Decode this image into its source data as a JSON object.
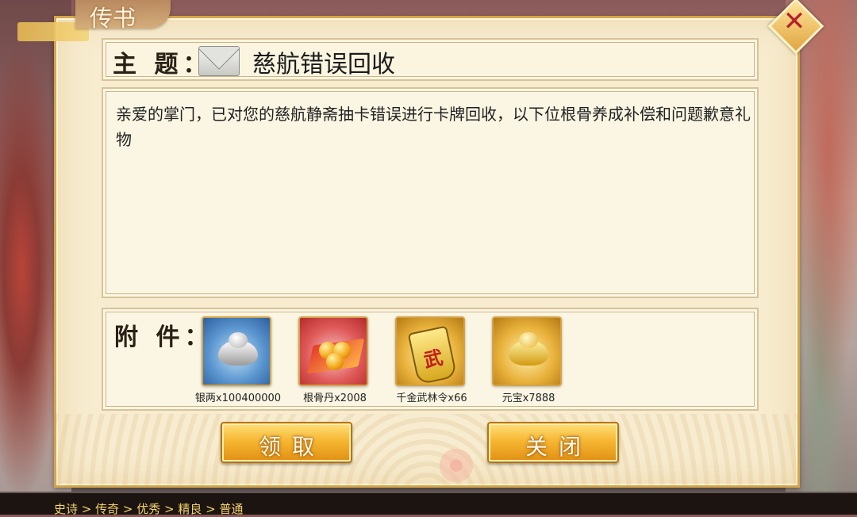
{
  "window": {
    "title": "传书",
    "close_icon": "close-icon"
  },
  "mail": {
    "subject_label": "主 题：",
    "subject_icon": "envelope-icon",
    "subject": "慈航错误回收",
    "body": "亲爱的掌门，已对您的慈航静斋抽卡错误进行卡牌回收，以下位根骨养成补偿和问题歉意礼物"
  },
  "attachments": {
    "label": "附 件：",
    "items": [
      {
        "name": "银两x100400000",
        "icon": "silver-ingot-icon",
        "bg": "blue"
      },
      {
        "name": "根骨丹x2008",
        "icon": "golden-pills-icon",
        "bg": "red"
      },
      {
        "name": "千金武林令x66",
        "icon": "martial-token-icon",
        "bg": "gold",
        "glyph": "武"
      },
      {
        "name": "元宝x7888",
        "icon": "gold-ingot-icon",
        "bg": "gold"
      }
    ]
  },
  "buttons": {
    "claim": "领取",
    "close": "关闭"
  },
  "footer": {
    "rarity_order": "史诗 > 传奇 > 优秀 > 精良 > 普通"
  },
  "colors": {
    "panel": "#f7eccf",
    "button": "#f7b733",
    "border": "#d3a64c",
    "rarity_text": "#f2d36b"
  }
}
